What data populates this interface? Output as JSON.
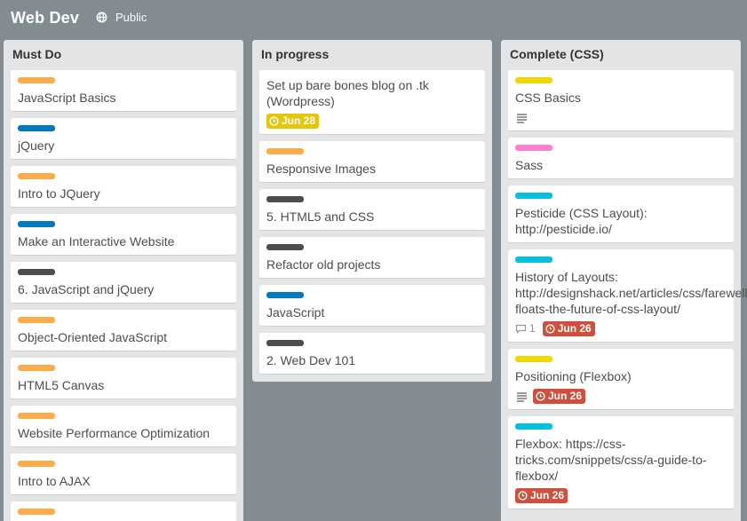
{
  "board": {
    "title": "Web Dev",
    "visibility": "Public"
  },
  "colors": {
    "orange": "#ffab4a",
    "blue": "#0079bf",
    "black": "#4d4d4d",
    "yellow": "#f2d600",
    "pink": "#ff80ce",
    "sky": "#00c2e0",
    "due_yellow": "#e6c60d",
    "due_red": "#cf513d"
  },
  "lists": [
    {
      "title": "Must Do",
      "cards": [
        {
          "label": "orange",
          "title": "JavaScript Basics"
        },
        {
          "label": "blue",
          "title": "jQuery"
        },
        {
          "label": "orange",
          "title": "Intro to JQuery"
        },
        {
          "label": "blue",
          "title": "Make an Interactive Website"
        },
        {
          "label": "black",
          "title": "6. JavaScript and jQuery"
        },
        {
          "label": "orange",
          "title": "Object-Oriented JavaScript"
        },
        {
          "label": "orange",
          "title": "HTML5 Canvas"
        },
        {
          "label": "orange",
          "title": "Website Performance Optimization"
        },
        {
          "label": "orange",
          "title": "Intro to AJAX"
        },
        {
          "label": "orange",
          "title": ""
        }
      ]
    },
    {
      "title": "In progress",
      "cards": [
        {
          "label": null,
          "title": "Set up bare bones blog on .tk (Wordpress)",
          "due": "Jun 28",
          "due_color": "due_yellow"
        },
        {
          "label": "orange",
          "title": "Responsive Images"
        },
        {
          "label": "black",
          "title": "5. HTML5 and CSS"
        },
        {
          "label": "black",
          "title": "Refactor old projects"
        },
        {
          "label": "blue",
          "title": "JavaScript"
        },
        {
          "label": "black",
          "title": "2. Web Dev 101"
        }
      ]
    },
    {
      "title": "Complete (CSS)",
      "cards": [
        {
          "label": "yellow",
          "title": "CSS Basics",
          "description": true
        },
        {
          "label": "pink",
          "title": "Sass"
        },
        {
          "label": "sky",
          "title": "Pesticide (CSS Layout): http://pesticide.io/"
        },
        {
          "label": "sky",
          "title": "History of Layouts: http://designshack.net/articles/css/farewell-floats-the-future-of-css-layout/",
          "comments": "1",
          "due": "Jun 26",
          "due_color": "due_red"
        },
        {
          "label": "yellow",
          "title": "Positioning (Flexbox)",
          "description": true,
          "due": "Jun 26",
          "due_color": "due_red"
        },
        {
          "label": "sky",
          "title": "Flexbox: https://css-tricks.com/snippets/css/a-guide-to-flexbox/",
          "due": "Jun 26",
          "due_color": "due_red"
        }
      ]
    }
  ]
}
